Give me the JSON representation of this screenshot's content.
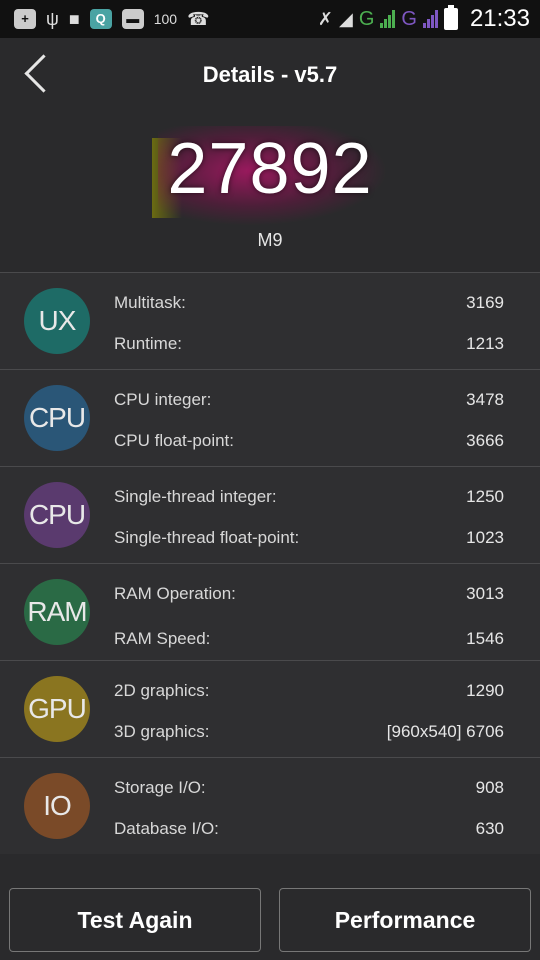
{
  "status_bar": {
    "battery_level": "100",
    "network_1": "G",
    "network_2": "G",
    "time": "21:33"
  },
  "header": {
    "title": "Details - v5.7"
  },
  "score": {
    "total": "27892",
    "device": "M9"
  },
  "colors": {
    "ux": "#1e6b66",
    "cpu": "#2a5677",
    "cpu2": "#5a3a6e",
    "ram": "#2a6a45",
    "gpu": "#8a7520",
    "io": "#7a4a28"
  },
  "categories": [
    {
      "badge": "UX",
      "items": [
        {
          "label": "Multitask:",
          "value": "3169"
        },
        {
          "label": "Runtime:",
          "value": "1213"
        }
      ]
    },
    {
      "badge": "CPU",
      "items": [
        {
          "label": "CPU integer:",
          "value": "3478"
        },
        {
          "label": "CPU float-point:",
          "value": "3666"
        }
      ]
    },
    {
      "badge": "CPU",
      "items": [
        {
          "label": "Single-thread integer:",
          "value": "1250"
        },
        {
          "label": "Single-thread float-point:",
          "value": "1023"
        }
      ]
    },
    {
      "badge": "RAM",
      "items": [
        {
          "label": "RAM Operation:",
          "value": "3013"
        },
        {
          "label": "RAM Speed:",
          "value": "1546"
        }
      ]
    },
    {
      "badge": "GPU",
      "items": [
        {
          "label": "2D graphics:",
          "value": "1290"
        },
        {
          "label": "3D graphics:",
          "value": "[960x540] 6706"
        }
      ]
    },
    {
      "badge": "IO",
      "items": [
        {
          "label": "Storage I/O:",
          "value": "908"
        },
        {
          "label": "Database I/O:",
          "value": "630"
        }
      ]
    }
  ],
  "buttons": {
    "test_again": "Test Again",
    "performance": "Performance"
  }
}
